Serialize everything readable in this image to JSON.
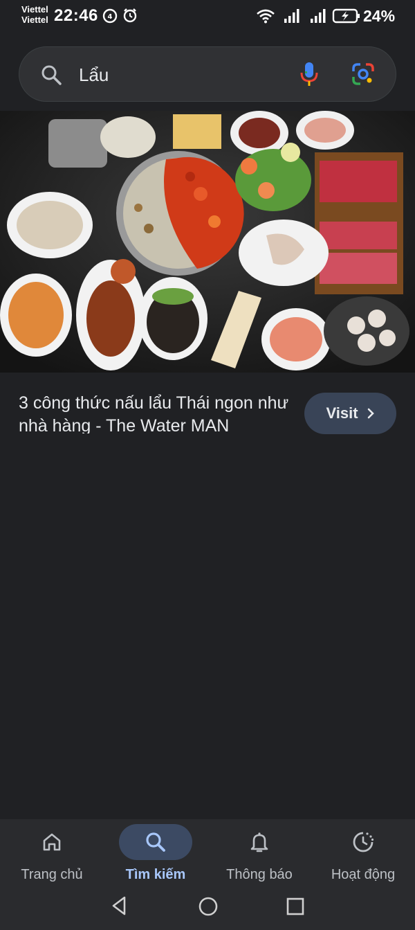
{
  "status_bar": {
    "carrier_1": "Viettel",
    "carrier_2": "Viettel",
    "time": "22:46",
    "battery": "24%"
  },
  "search": {
    "query": "Lẩu",
    "icons": [
      "search-icon",
      "mic-icon",
      "google-lens-icon"
    ]
  },
  "result": {
    "title": "3 công thức nấu lẩu Thái ngon như nhà hàng - The Water MAN",
    "visit_label": "Visit"
  },
  "bottom_nav": {
    "items": [
      {
        "label": "Trang chủ",
        "icon": "home-icon"
      },
      {
        "label": "Tìm kiếm",
        "icon": "search-icon",
        "active": true
      },
      {
        "label": "Thông báo",
        "icon": "bell-icon"
      },
      {
        "label": "Hoạt động",
        "icon": "activity-icon"
      }
    ]
  },
  "colors": {
    "background": "#202124",
    "search_bg": "#303134",
    "visit_bg": "#394457",
    "active_nav": "#a8c7fa"
  }
}
